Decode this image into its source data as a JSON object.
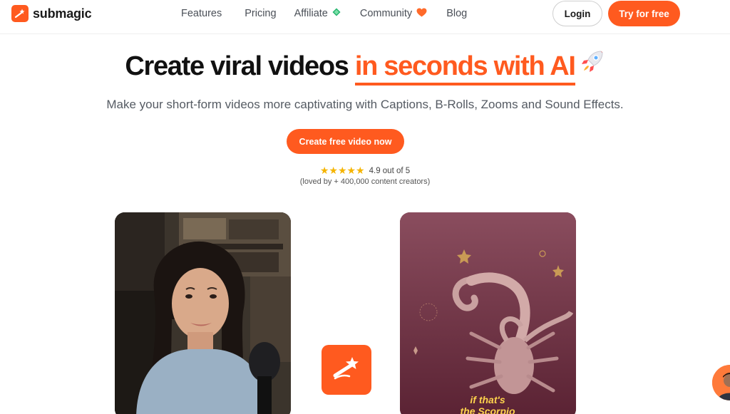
{
  "brand": {
    "name": "submagic",
    "color": "#ff5a1f"
  },
  "nav": {
    "links": [
      {
        "label": "Features",
        "icon": null
      },
      {
        "label": "Pricing",
        "icon": null
      },
      {
        "label": "Affiliate",
        "icon": "green-diamond-icon"
      },
      {
        "label": "Community",
        "icon": "orange-heart-icon"
      },
      {
        "label": "Blog",
        "icon": null
      }
    ],
    "login_label": "Login",
    "try_label": "Try for free"
  },
  "hero": {
    "title_part1": "Create viral videos ",
    "title_highlight": "in seconds with AI",
    "title_icon": "rocket-icon",
    "subtitle": "Make your short-form videos more captivating with Captions, B-Rolls, Zooms and Sound Effects.",
    "cta_label": "Create free video now",
    "rating_stars": 5,
    "rating_text": "4.9 out of 5",
    "loved_text": "(loved by + 400,000 content creators)"
  },
  "videos": {
    "left_card_icon": "woman-podcast-image",
    "right_card_icon": "scorpion-zodiac-image",
    "right_caption_line1": "if that's",
    "right_caption_line2": "the Scorpio"
  },
  "colors": {
    "accent": "#ff5a1f",
    "star": "#f5b400",
    "text_muted": "#555b63"
  }
}
